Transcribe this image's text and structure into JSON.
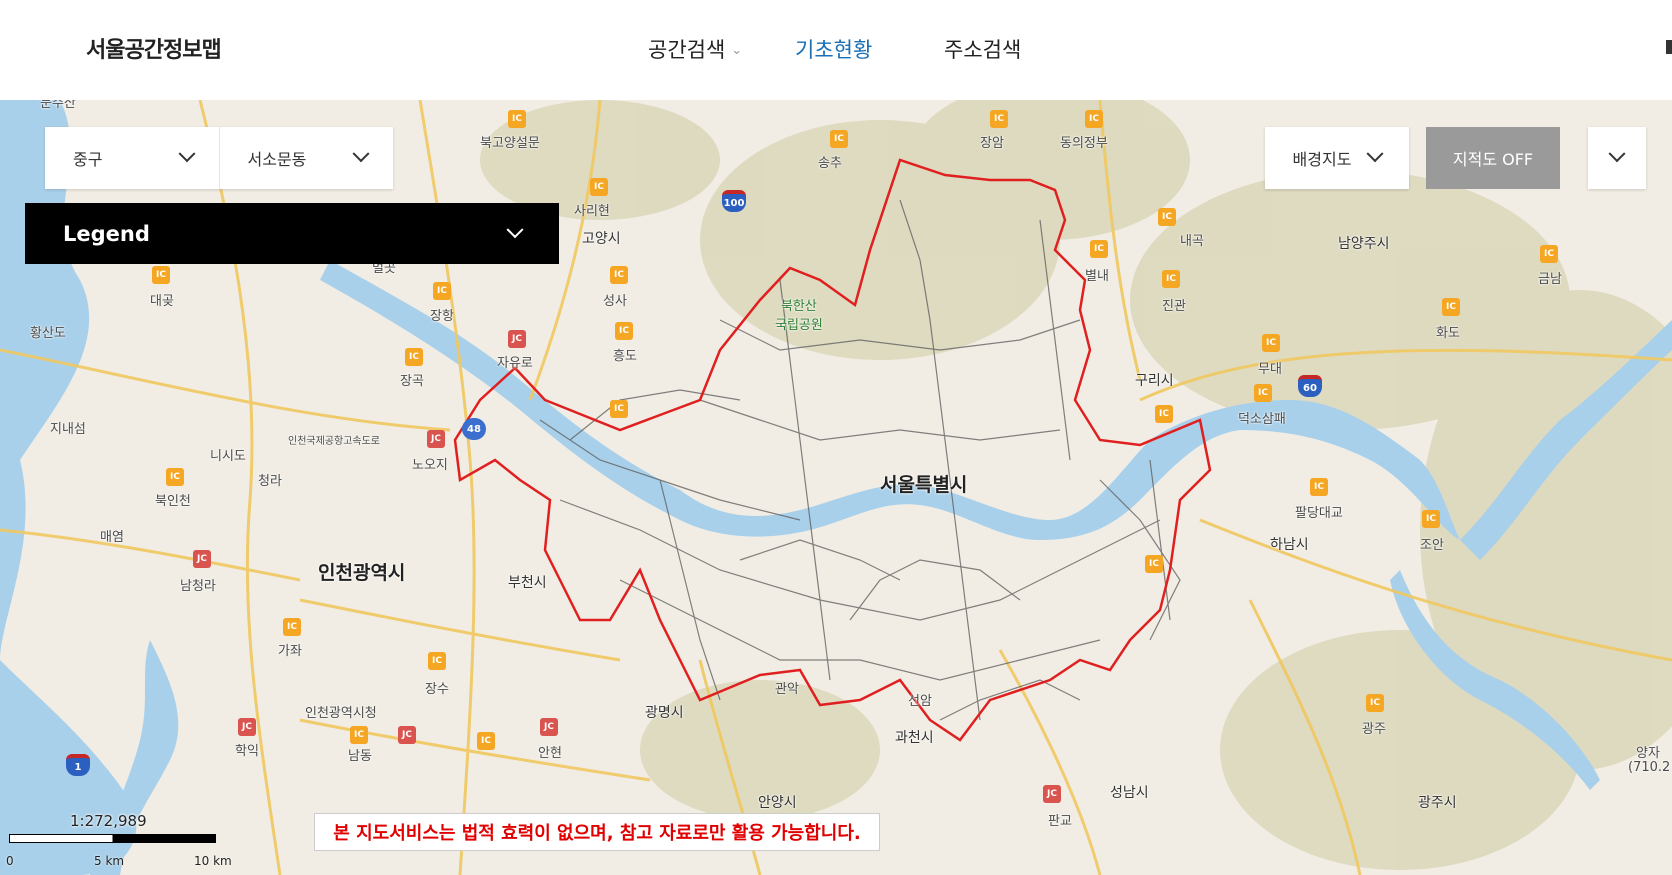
{
  "header": {
    "logo": "서울공간정보맵",
    "nav": [
      {
        "label": "공간검색",
        "active": false,
        "has_dropdown": true
      },
      {
        "label": "기초현황",
        "active": true,
        "has_dropdown": false
      },
      {
        "label": "주소검색",
        "active": false,
        "has_dropdown": false
      }
    ],
    "active_color": "#1a6fb5"
  },
  "controls": {
    "district": "중구",
    "neighborhood": "서소문동",
    "legend_label": "Legend",
    "basemap_label": "배경지도",
    "cadastral_label": "지적도 OFF"
  },
  "scale": {
    "ratio": "1:272,989",
    "ticks": [
      "0",
      "5 km",
      "10 km"
    ]
  },
  "disclaimer": "본 지도서비스는 법적 효력이 없으며, 참고 자료로만 활용 가능합니다.",
  "map_labels": {
    "munsan": "문주산",
    "bukgoyang": "북고양설문",
    "songchu": "송추",
    "jangam": "장암",
    "dongui": "동의정부",
    "sarihyeon": "사리현",
    "goyang": "고양시",
    "beolgot": "벌곳",
    "daegot": "대곶",
    "janghang": "장항",
    "seongsa": "성사",
    "hwangsando": "황산도",
    "heungdo": "흥도",
    "jayuro": "자유로",
    "janggok": "장곡",
    "jinaeseom": "지내섬",
    "nojiji": "노오지",
    "incheon_airport_road": "인천국제공항고속도로",
    "nisido": "니시도",
    "cheongna": "청라",
    "bugincheon": "북인천",
    "maeyeom": "매염",
    "incheon": "인천광역시",
    "bucheon": "부천시",
    "namcheongna": "남청라",
    "gajwa": "가좌",
    "jangsu": "장수",
    "incheon_cityhall": "인천광역시청",
    "hakik": "학익",
    "namdong": "남동",
    "gwangmyeong": "광명시",
    "anhyeon": "안현",
    "anyang": "안양시",
    "gwacheon": "과천시",
    "gwanak": "관악",
    "seonam": "선암",
    "seongnam": "성남시",
    "pangyo": "판교",
    "bukhansan": "북한산\n국립공원",
    "seoul": "서울특별시",
    "naegok": "내곡",
    "byeolnae": "별내",
    "jingwan": "진관",
    "namyangju": "남양주시",
    "geumnam": "금남",
    "hwado": "화도",
    "mudae": "무대",
    "guri": "구리시",
    "deokso": "덕소삼패",
    "paldang": "팔당대교",
    "hanam": "하남시",
    "joan": "조안",
    "gwangju_lbl": "광주",
    "gwangju": "광주시",
    "yangja": "양자",
    "elev": "(710.2"
  },
  "colors": {
    "boundary": "#e02020",
    "river": "#a9d0ea",
    "mountain": "#d6d3b5",
    "road": "#f0c860",
    "network": "#555555"
  }
}
